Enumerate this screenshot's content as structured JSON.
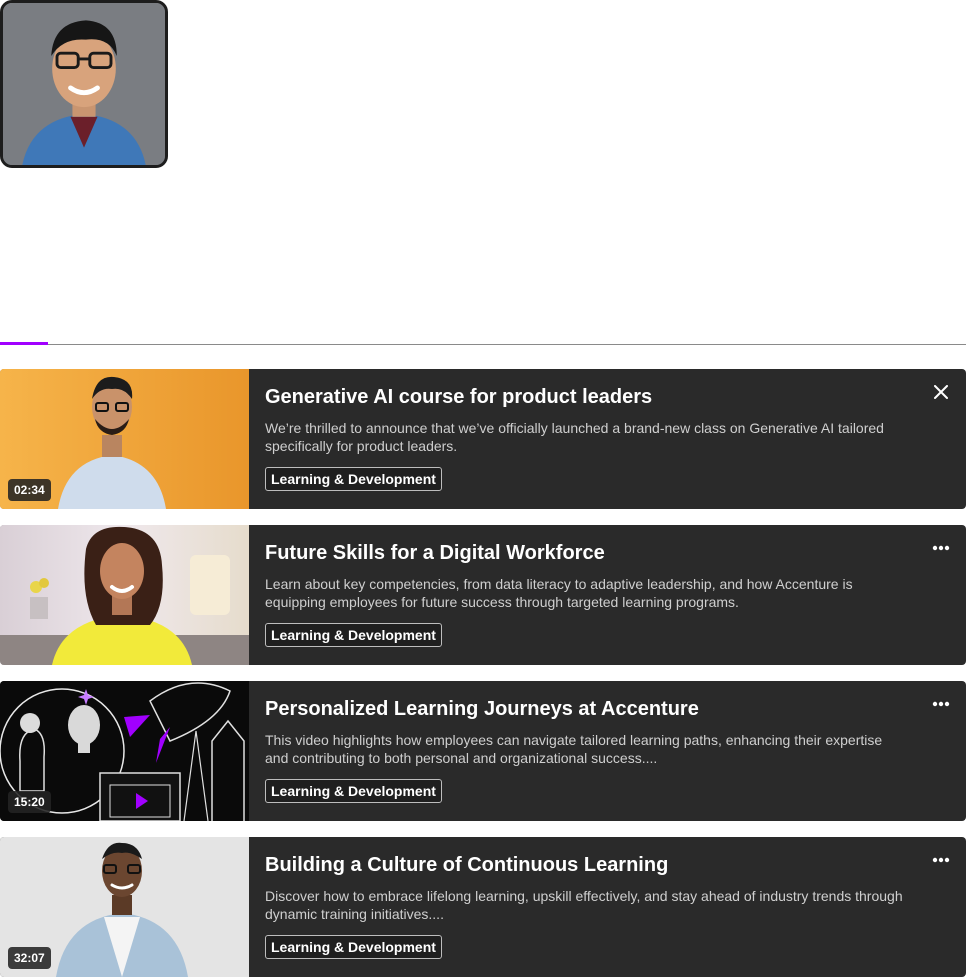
{
  "profile": {
    "avatar_alt": "profile-photo"
  },
  "progress": {
    "fraction": 0.05,
    "accent": "#a100ff"
  },
  "cards": [
    {
      "title": "Generative AI course for product leaders",
      "description": "We’re thrilled to announce that we’ve officially launched a brand-new class on Generative AI tailored specifically for product leaders.",
      "tag": "Learning & Development",
      "duration": "02:34",
      "action_icon": "close-icon"
    },
    {
      "title": "Future Skills for a Digital Workforce",
      "description": "Learn about key competencies, from data literacy to adaptive leadership, and how Accenture is equipping employees for future success through targeted learning programs.",
      "tag": "Learning & Development",
      "duration": "",
      "action_icon": "more-options-icon"
    },
    {
      "title": "Personalized Learning Journeys at Accenture",
      "description": "This video highlights how employees can navigate tailored learning paths, enhancing their expertise and contributing to both personal and organizational success....",
      "tag": "Learning & Development",
      "duration": "15:20",
      "action_icon": "more-options-icon"
    },
    {
      "title": "Building a Culture of Continuous Learning",
      "description": "Discover how to embrace lifelong learning, upskill effectively, and stay ahead of industry trends through dynamic training initiatives....",
      "tag": "Learning & Development",
      "duration": "32:07",
      "action_icon": "more-options-icon"
    }
  ]
}
